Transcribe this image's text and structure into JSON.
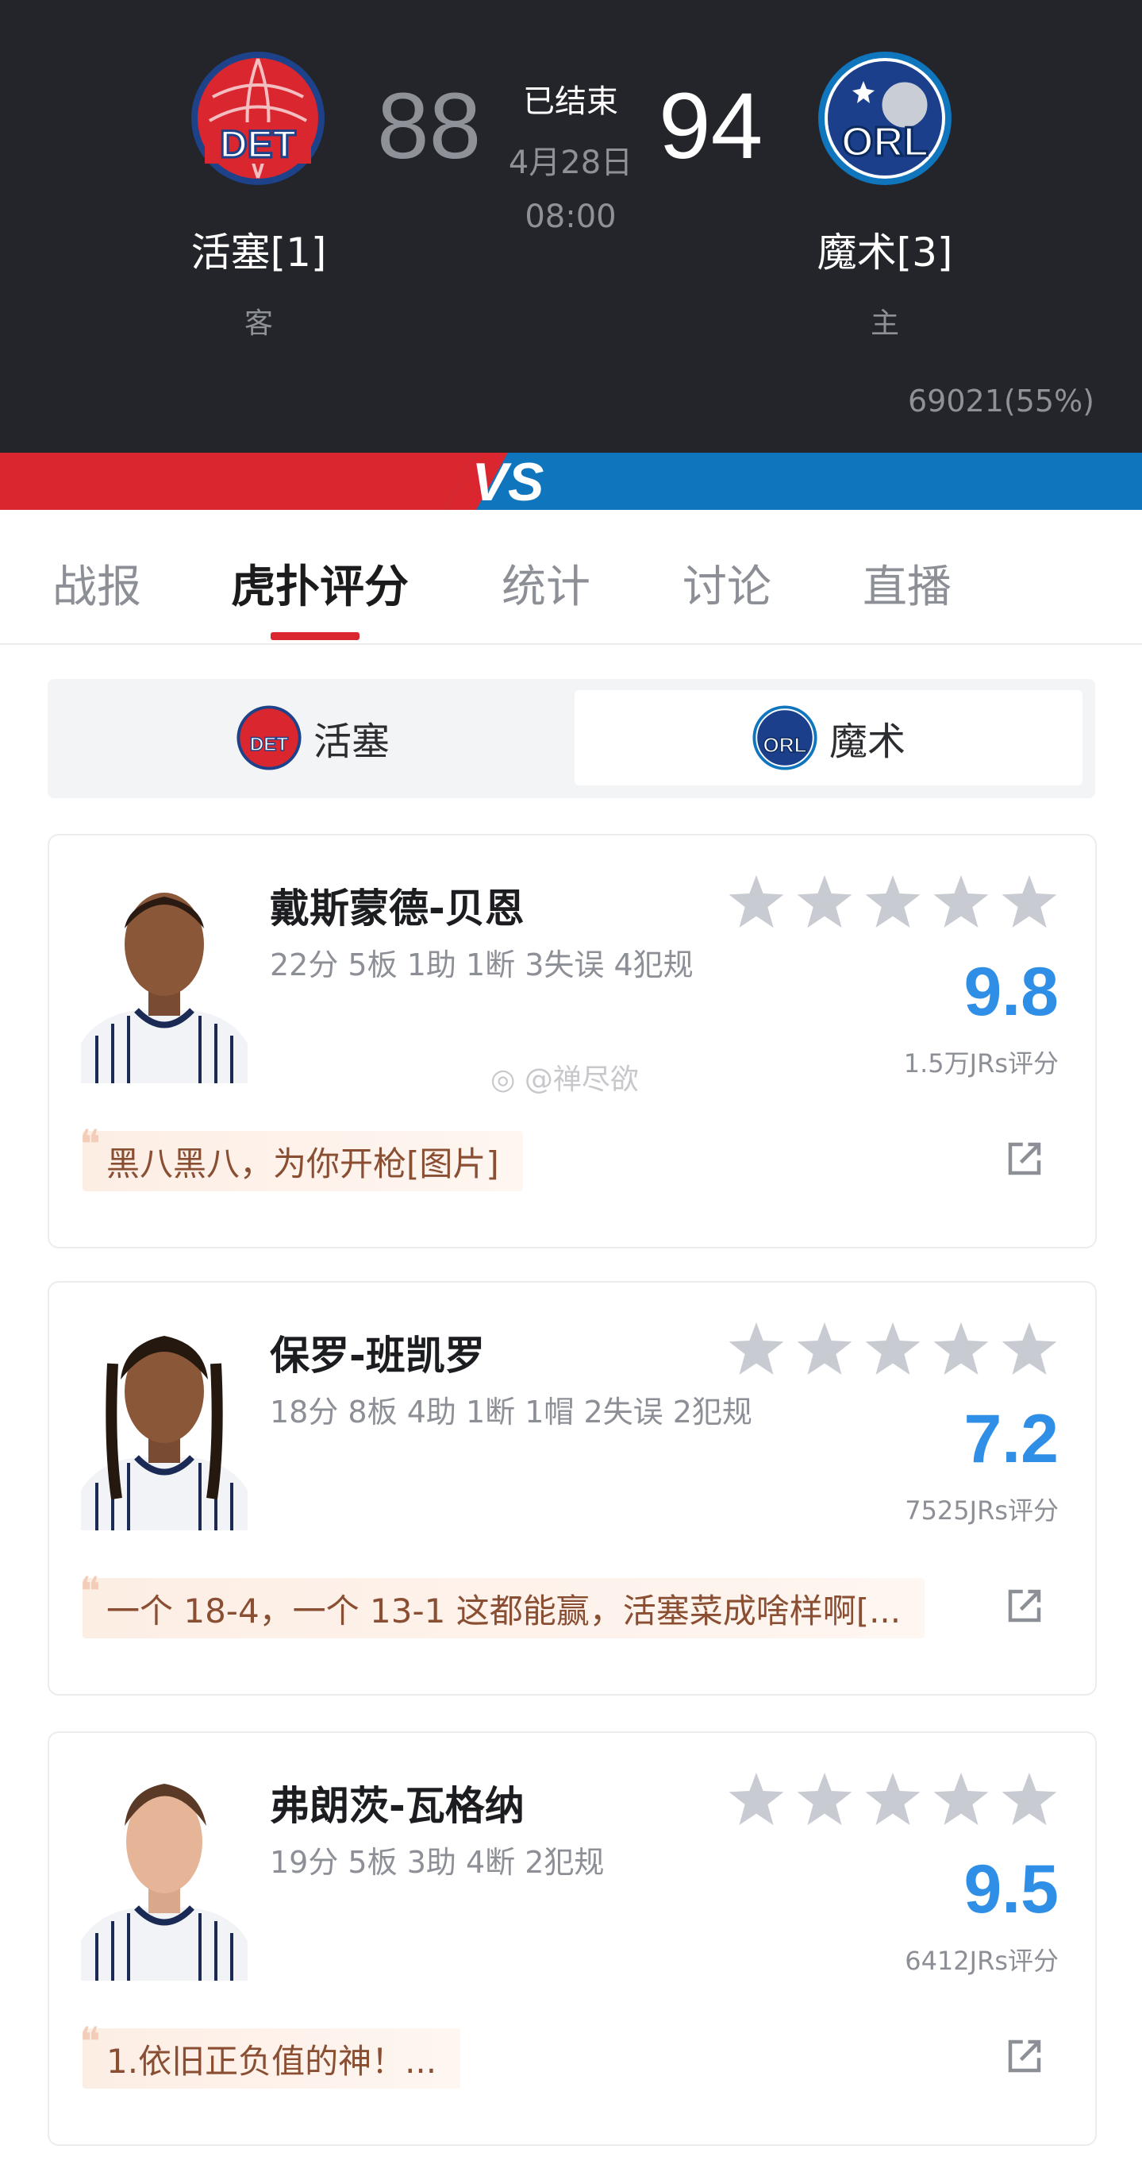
{
  "game": {
    "away": {
      "name": "活塞[1]",
      "role": "客",
      "score": "88",
      "logo_text": "DET"
    },
    "home": {
      "name": "魔术[3]",
      "role": "主",
      "score": "94",
      "logo_text": "ORL"
    },
    "status": "已结束",
    "date": "4月28日",
    "time": "08:00",
    "attendance": "69021(55%)",
    "vs_label": "VS"
  },
  "colors": {
    "away": "#d9262f",
    "home": "#0f75bd",
    "rating": "#2f8fe6"
  },
  "tabs": [
    {
      "label": "战报",
      "active": false
    },
    {
      "label": "虎扑评分",
      "active": true
    },
    {
      "label": "统计",
      "active": false
    },
    {
      "label": "讨论",
      "active": false
    },
    {
      "label": "直播",
      "active": false
    }
  ],
  "team_switch": {
    "away_label": "活塞",
    "home_label": "魔术",
    "selected": "魔术"
  },
  "players": [
    {
      "name": "戴斯蒙德-贝恩",
      "stats": "22分 5板 1助 1断 3失误 4犯规",
      "rating": "9.8",
      "raters": "1.5万JRs评分",
      "comment": "黑八黑八，为你开枪[图片]"
    },
    {
      "name": "保罗-班凯罗",
      "stats": "18分 8板 4助 1断 1帽 2失误 2犯规",
      "rating": "7.2",
      "raters": "7525JRs评分",
      "comment": "一个 18-4，一个 13-1 这都能赢，活塞菜成啥样啊[..."
    },
    {
      "name": "弗朗茨-瓦格纳",
      "stats": "19分 5板 3助 4断 2犯规",
      "rating": "9.5",
      "raters": "6412JRs评分",
      "comment": "1.依旧正负值的神！..."
    }
  ],
  "watermark": "@禅尽欲",
  "icons": [
    "star-icon",
    "share-icon",
    "quote-icon",
    "weibo-icon"
  ]
}
